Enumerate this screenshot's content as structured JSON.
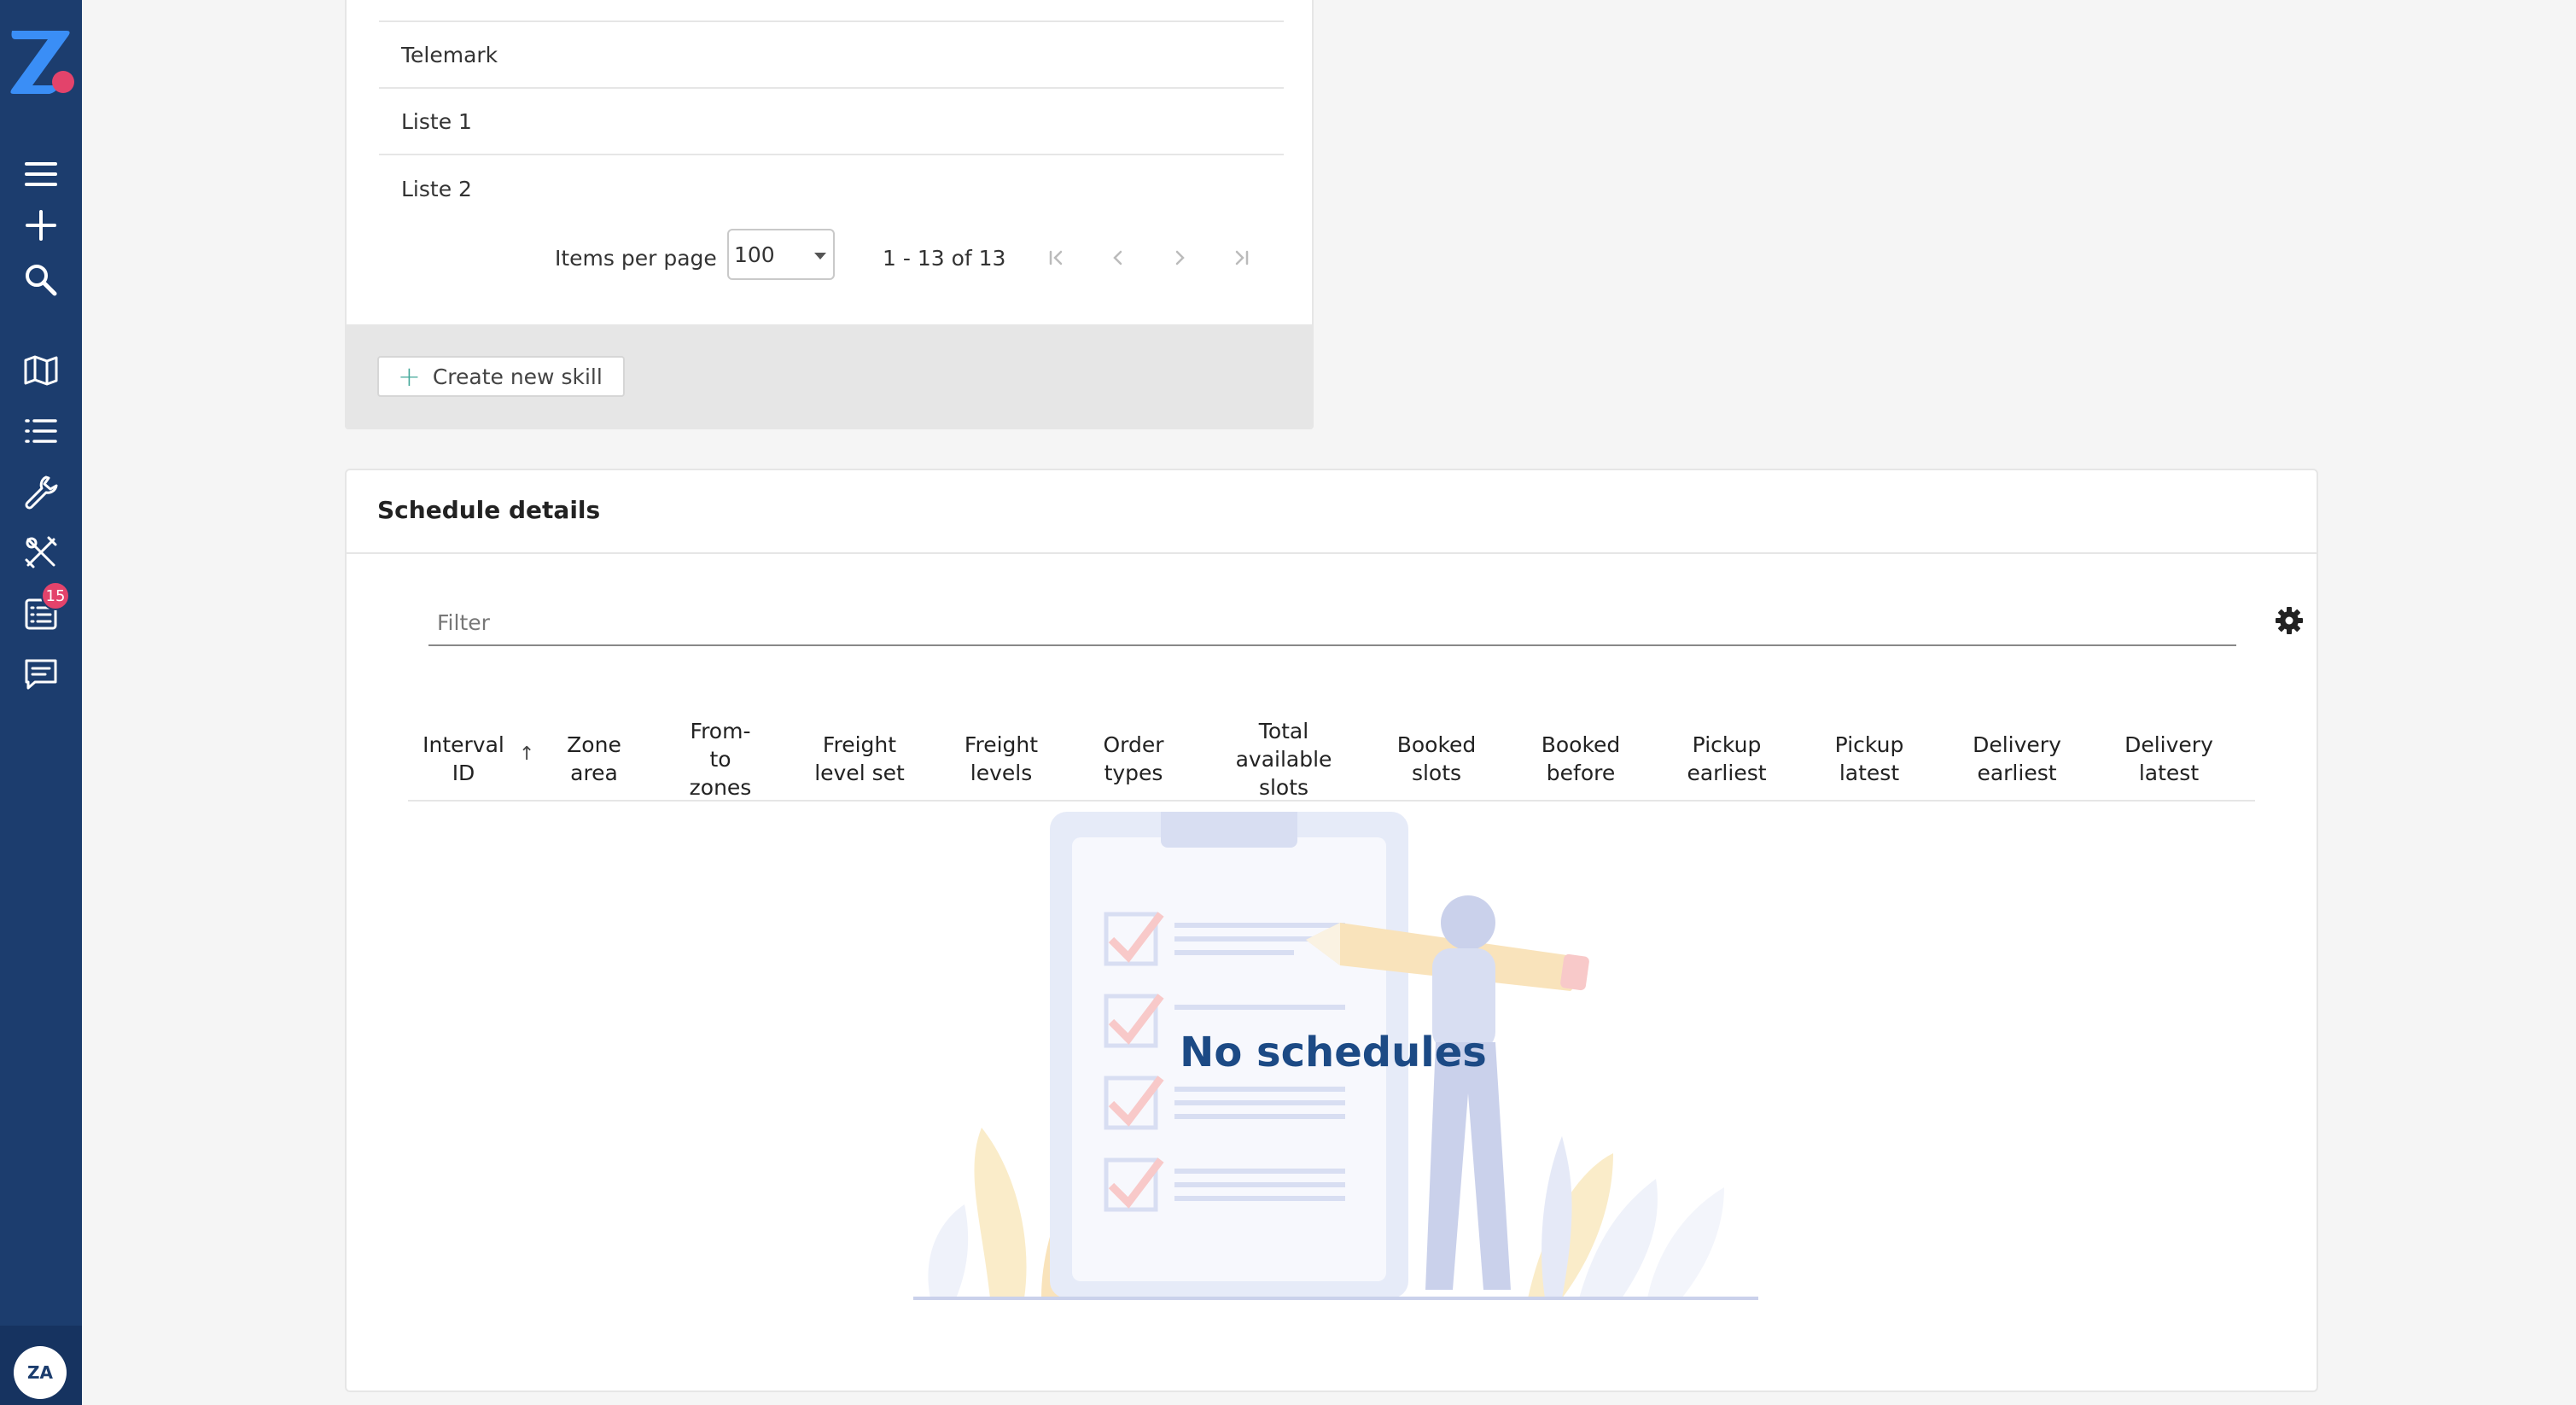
{
  "sidebar": {
    "badge_count": "15",
    "avatar_initials": "ZA",
    "icons": [
      "menu-icon",
      "plus-icon",
      "search-icon",
      "map-icon",
      "list-icon",
      "wrench-icon",
      "tools-icon",
      "checklist-icon",
      "chat-icon"
    ]
  },
  "skills": {
    "rows": [
      "Telemark",
      "Liste 1",
      "Liste 2"
    ],
    "paginator": {
      "items_per_page_label": "Items per page",
      "items_per_page_value": "100",
      "range_label": "1 - 13 of 13"
    },
    "create_button_label": "Create new skill"
  },
  "schedule": {
    "title": "Schedule details",
    "filter_placeholder": "Filter",
    "columns": [
      "Interval ID",
      "Zone area",
      "From-to zones",
      "Freight level set",
      "Freight levels",
      "Order types",
      "Total available slots",
      "Booked slots",
      "Booked before",
      "Pickup earliest",
      "Pickup latest",
      "Delivery earliest",
      "Delivery latest"
    ],
    "sorted_column_arrow": "↑",
    "empty_text": "No schedules"
  },
  "colors": {
    "sidebar": "#1c3d6e",
    "accent_pink": "#e3436b",
    "logo_blue": "#3a8ef6",
    "empty_text": "#1c4a85"
  }
}
